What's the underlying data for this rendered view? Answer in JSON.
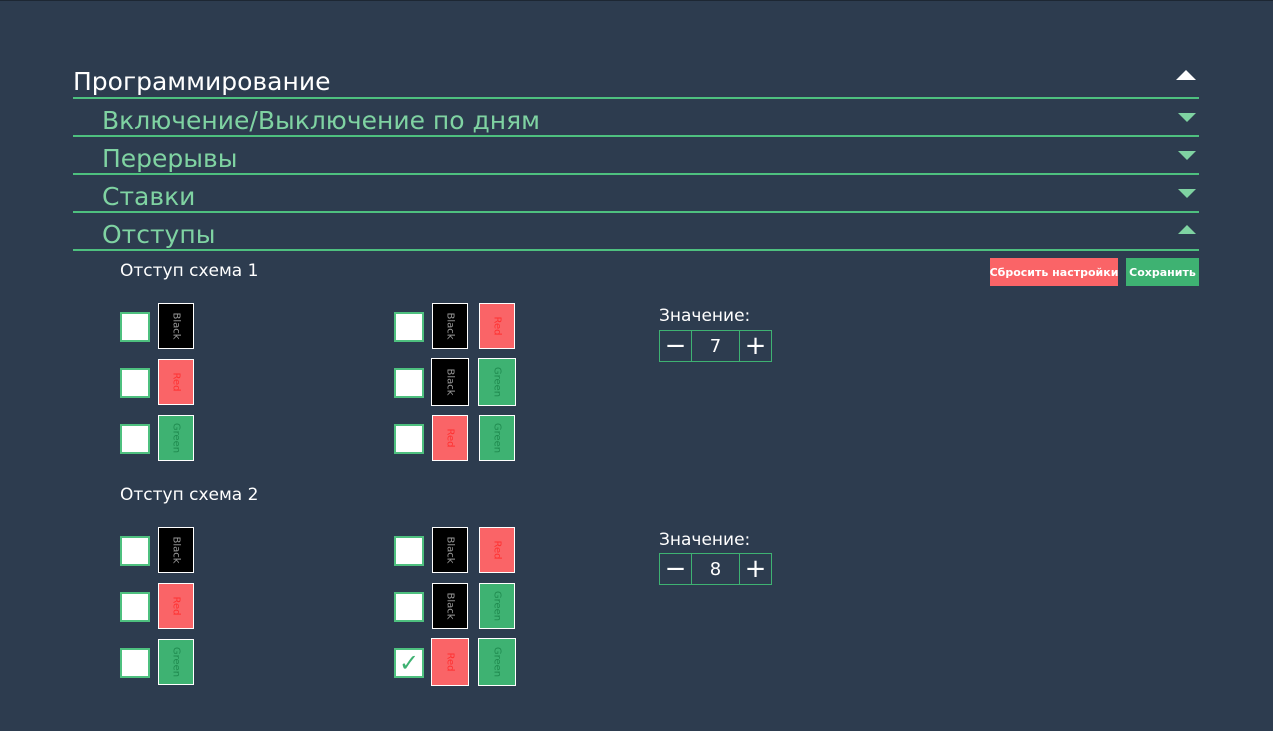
{
  "accordion": {
    "main_title": "Программирование",
    "sections": [
      {
        "label": "Включение/Выключение по дням",
        "expanded": false
      },
      {
        "label": "Перерывы",
        "expanded": false
      },
      {
        "label": "Ставки",
        "expanded": false
      },
      {
        "label": "Отступы",
        "expanded": true
      }
    ]
  },
  "actions": {
    "reset_label": "Сбросить настройки",
    "save_label": "Сохранить"
  },
  "schemes": [
    {
      "title": "Отступ схема 1",
      "value_label": "Значение:",
      "value": "7",
      "left_column": [
        {
          "checked": false,
          "color": "Black"
        },
        {
          "checked": false,
          "color": "Red"
        },
        {
          "checked": false,
          "color": "Green"
        }
      ],
      "right_column": [
        {
          "checked": false,
          "colors": [
            "Black",
            "Red"
          ]
        },
        {
          "checked": false,
          "colors": [
            "Black",
            "Green"
          ]
        },
        {
          "checked": false,
          "colors": [
            "Red",
            "Green"
          ]
        }
      ]
    },
    {
      "title": "Отступ схема 2",
      "value_label": "Значение:",
      "value": "8",
      "left_column": [
        {
          "checked": false,
          "color": "Black"
        },
        {
          "checked": false,
          "color": "Red"
        },
        {
          "checked": false,
          "color": "Green"
        }
      ],
      "right_column": [
        {
          "checked": false,
          "colors": [
            "Black",
            "Red"
          ]
        },
        {
          "checked": false,
          "colors": [
            "Black",
            "Green"
          ]
        },
        {
          "checked": true,
          "colors": [
            "Red",
            "Green"
          ]
        }
      ]
    }
  ],
  "colors": {
    "background": "#2d3c4f",
    "accent_green": "#3eb272",
    "red": "#fa6467",
    "black": "#000000"
  },
  "icons": {
    "expanded": "triangle-up-icon",
    "collapsed": "triangle-down-icon",
    "check": "checkmark-icon"
  }
}
